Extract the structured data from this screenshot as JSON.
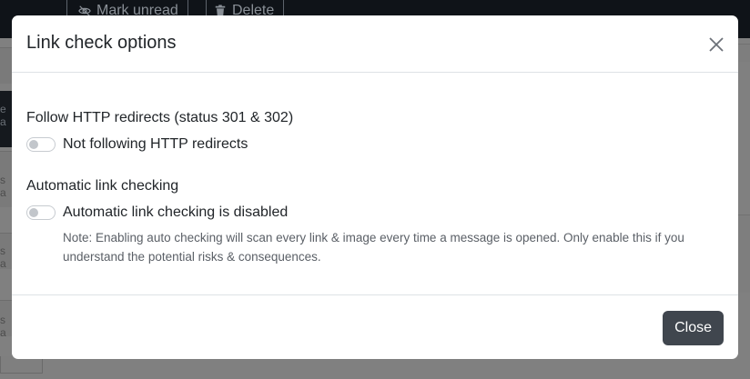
{
  "background": {
    "toolbar": {
      "mark_unread_label": "Mark unread",
      "delete_label": "Delete"
    },
    "row_fragments": [
      "e a",
      "s a",
      "s a",
      "s a"
    ]
  },
  "dialog": {
    "title": "Link check options",
    "sections": [
      {
        "heading": "Follow HTTP redirects (status 301 & 302)",
        "toggle_label": "Not following HTTP redirects",
        "enabled": false
      },
      {
        "heading": "Automatic link checking",
        "toggle_label": "Automatic link checking is disabled",
        "enabled": false,
        "note": "Note: Enabling auto checking will scan every link & image every time a message is opened. Only enable this if you understand the potential risks & consequences."
      }
    ],
    "close_button_label": "Close"
  },
  "colors": {
    "overlay": "#808080",
    "topbar": "#0f1318",
    "close_button_bg": "#40464e",
    "divider": "#dee2e6"
  },
  "icons": {
    "mark_unread": "eye-slash-icon",
    "delete": "trash-icon",
    "dismiss": "close-icon"
  }
}
